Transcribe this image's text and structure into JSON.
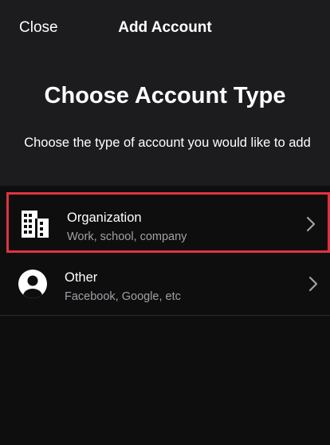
{
  "nav": {
    "close_label": "Close",
    "title": "Add Account"
  },
  "header": {
    "heading": "Choose Account Type",
    "subtitle": "Choose the type of account you would like to add"
  },
  "options": [
    {
      "title": "Organization",
      "subtitle": "Work, school, company",
      "icon": "building-icon",
      "highlighted": true
    },
    {
      "title": "Other",
      "subtitle": "Facebook, Google, etc",
      "icon": "person-icon",
      "highlighted": false
    }
  ],
  "colors": {
    "background": "#1c1c1e",
    "list_background": "#0e0e0f",
    "highlight_border": "#e0323f",
    "secondary_text": "#a1a1a6"
  }
}
